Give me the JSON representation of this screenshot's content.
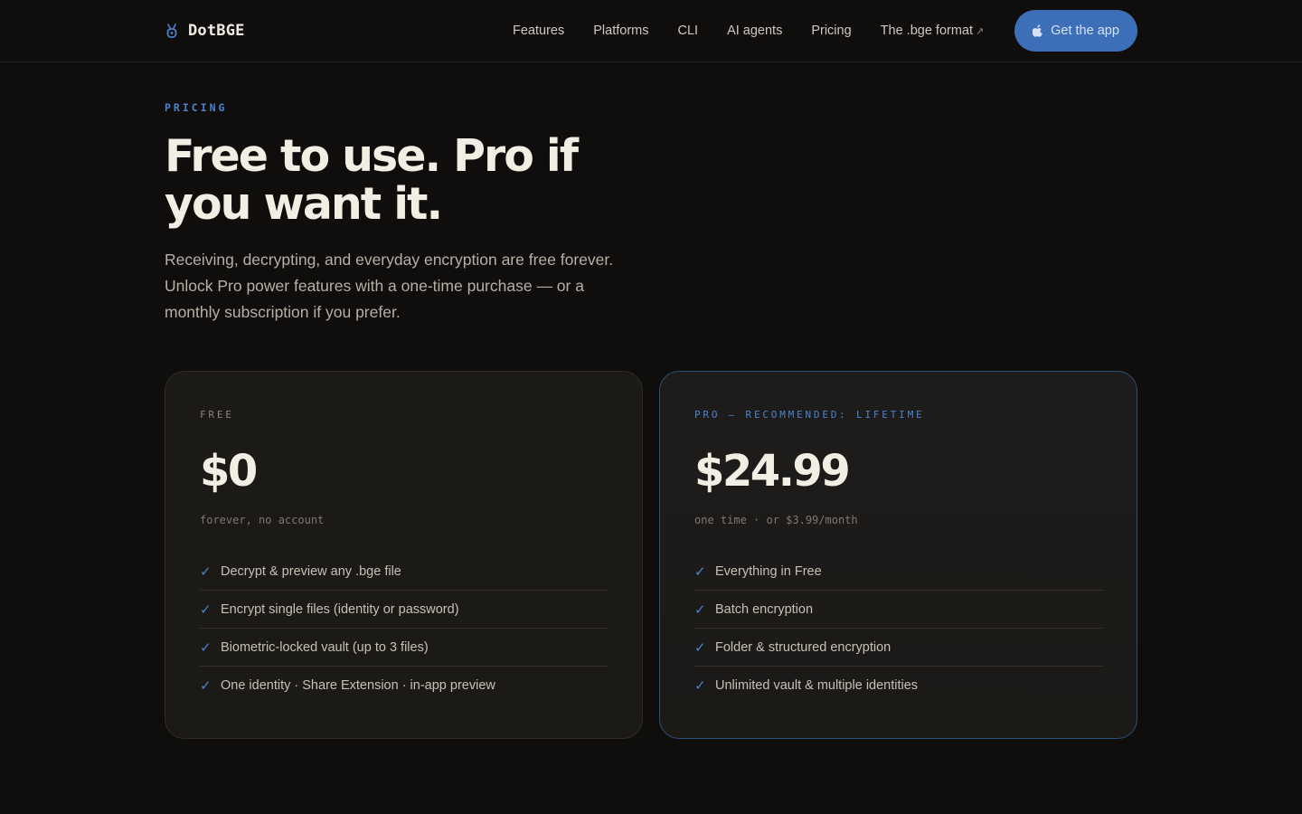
{
  "nav": {
    "brand": "DotBGE",
    "links": [
      "Features",
      "Platforms",
      "CLI",
      "AI agents",
      "Pricing",
      "The .bge format"
    ],
    "external_arrow": "↗",
    "cta_label": "Get the app"
  },
  "hero": {
    "eyebrow": "PRICING",
    "headline": "Free to use. Pro if you want it.",
    "lede": "Receiving, decrypting, and everyday encryption are free forever. Unlock Pro power features with a one-time purchase — or a monthly subscription if you prefer."
  },
  "plans": [
    {
      "tier": "FREE",
      "price": "$0",
      "note": "forever, no account",
      "features": [
        "Decrypt & preview any .bge file",
        "Encrypt single files (identity or password)",
        "Biometric-locked vault (up to 3 files)",
        "One identity · Share Extension · in-app preview"
      ]
    },
    {
      "tier": "PRO — RECOMMENDED: LIFETIME",
      "price": "$24.99",
      "note": "one time · or $3.99/month",
      "features": [
        "Everything in Free",
        "Batch encryption",
        "Folder & structured encryption",
        "Unlimited vault & multiple identities"
      ]
    }
  ],
  "icons": {
    "brand": "shield-key-icon",
    "cta": "apple-icon",
    "feature": "checkmark-icon"
  },
  "colors": {
    "background": "#0f0e0d",
    "accent": "#3d6fb8",
    "accent_text": "#4a82d0",
    "card": "#1c1a17"
  }
}
